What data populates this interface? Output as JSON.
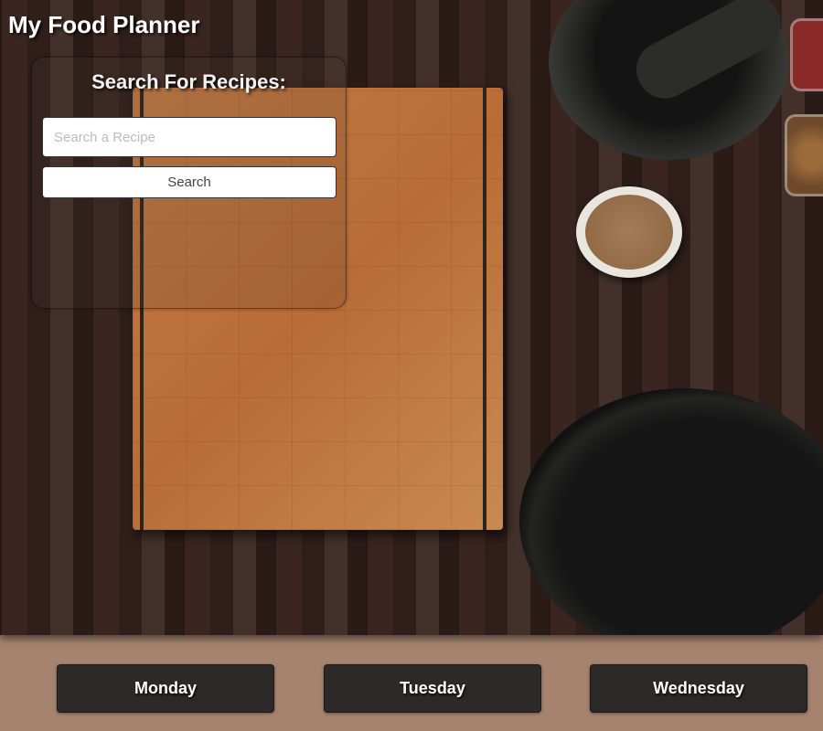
{
  "header": {
    "title": "My Food Planner"
  },
  "search": {
    "heading": "Search For Recipes:",
    "input_value": "",
    "placeholder": "Search a Recipe",
    "button_label": "Search"
  },
  "days": [
    {
      "label": "Monday"
    },
    {
      "label": "Tuesday"
    },
    {
      "label": "Wednesday"
    }
  ],
  "colors": {
    "footer_bg": "#a5836f",
    "day_button_bg": "#2b2a28"
  }
}
